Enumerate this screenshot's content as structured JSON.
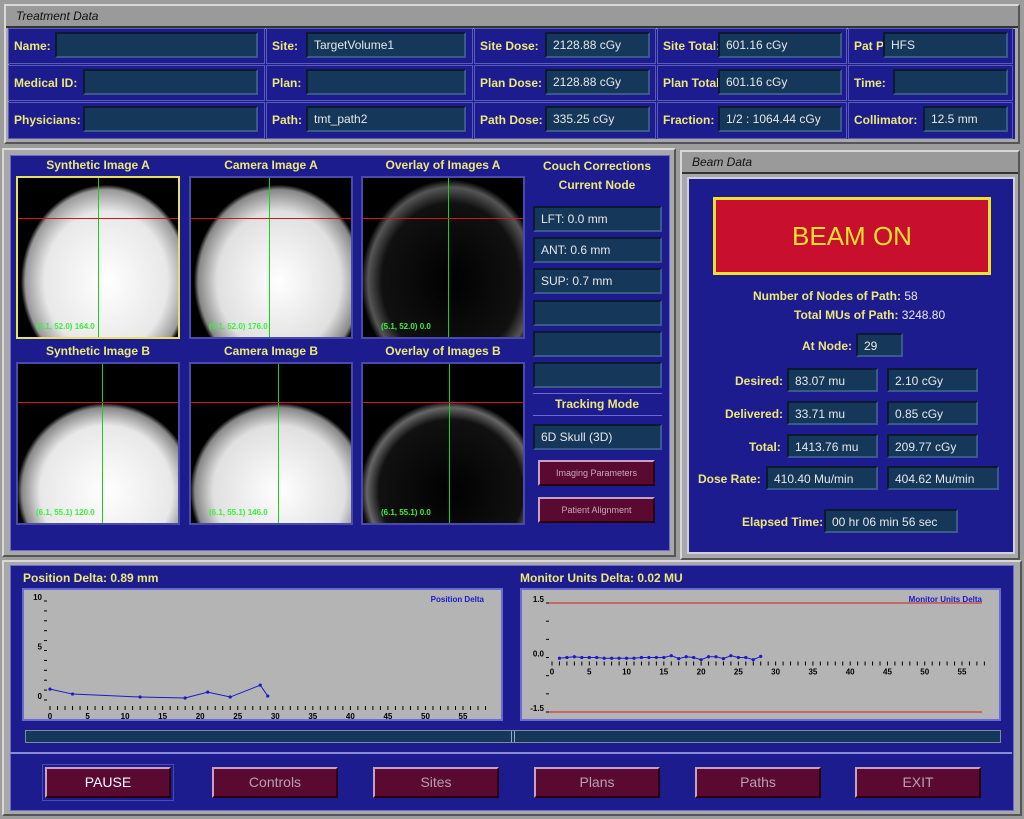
{
  "treatment": {
    "title": "Treatment Data",
    "name": {
      "label": "Name:",
      "value": ""
    },
    "medical_id": {
      "label": "Medical ID:",
      "value": ""
    },
    "physicians": {
      "label": "Physicians:",
      "value": ""
    },
    "site": {
      "label": "Site:",
      "value": "TargetVolume1"
    },
    "plan": {
      "label": "Plan:",
      "value": ""
    },
    "path": {
      "label": "Path:",
      "value": "tmt_path2"
    },
    "site_dose": {
      "label": "Site Dose:",
      "value": "2128.88 cGy"
    },
    "plan_dose": {
      "label": "Plan Dose:",
      "value": "2128.88 cGy"
    },
    "path_dose": {
      "label": "Path Dose:",
      "value": "335.25 cGy"
    },
    "site_total": {
      "label": "Site Total:",
      "value": "601.16 cGy"
    },
    "plan_total": {
      "label": "Plan Total:",
      "value": "601.16 cGy"
    },
    "fraction": {
      "label": "Fraction:",
      "value": "1/2 : 1064.44 cGy"
    },
    "pat_pos": {
      "label": "Pat  Pos:",
      "value": "HFS"
    },
    "time": {
      "label": "Time:",
      "value": ""
    },
    "collimator": {
      "label": "Collimator:",
      "value": "12.5 mm"
    }
  },
  "images": {
    "syn_a": {
      "label": "Synthetic Image A",
      "coord": "(5.1, 52.0) 164.0"
    },
    "cam_a": {
      "label": "Camera Image A",
      "coord": "(5.1, 52.0) 176.0"
    },
    "ovl_a": {
      "label": "Overlay of Images A",
      "coord": "(5.1, 52.0) 0.0"
    },
    "syn_b": {
      "label": "Synthetic Image B",
      "coord": "(6.1, 55.1) 120.0"
    },
    "cam_b": {
      "label": "Camera Image B",
      "coord": "(6.1, 55.1) 146.0"
    },
    "ovl_b": {
      "label": "Overlay of Images B",
      "coord": "(6.1, 55.1) 0.0"
    }
  },
  "couch": {
    "title": "Couch Corrections",
    "subtitle": "Current Node",
    "lft": "LFT: 0.0 mm",
    "ant": "ANT: 0.6 mm",
    "sup": "SUP: 0.7 mm",
    "tracking_label": "Tracking Mode",
    "tracking_value": "6D Skull (3D)",
    "imaging_btn": "Imaging Parameters",
    "alignment_btn": "Patient Alignment"
  },
  "beam": {
    "title": "Beam Data",
    "status": "BEAM ON",
    "status_bg": "#c8102e",
    "status_fg": "#f0e030",
    "nodes_label": "Number of Nodes of Path:",
    "nodes": "58",
    "mus_label": "Total MUs of Path:",
    "mus": "3248.80",
    "at_node_label": "At Node:",
    "at_node": "29",
    "desired_label": "Desired:",
    "desired_mu": "83.07 mu",
    "desired_cgy": "2.10 cGy",
    "delivered_label": "Delivered:",
    "delivered_mu": "33.71 mu",
    "delivered_cgy": "0.85 cGy",
    "total_label": "Total:",
    "total_mu": "1413.76 mu",
    "total_cgy": "209.77 cGy",
    "rate_label": "Dose Rate:",
    "rate1": "410.40 Mu/min",
    "rate2": "404.62 Mu/min",
    "elapsed_label": "Elapsed Time:",
    "elapsed": "00 hr  06 min  56 sec"
  },
  "buttons": {
    "pause": "PAUSE",
    "controls": "Controls",
    "sites": "Sites",
    "plans": "Plans",
    "paths": "Paths",
    "exit": "EXIT"
  },
  "chart_data": [
    {
      "type": "line",
      "title": "Position Delta: 0.89 mm",
      "legend": "Position Delta",
      "legend_position": "top-right",
      "ylim": [
        0,
        10
      ],
      "xlim": [
        0,
        58
      ],
      "yticks": [
        "0",
        "5",
        "10"
      ],
      "xticks": [
        "0",
        "5",
        "10",
        "15",
        "20",
        "25",
        "30",
        "35",
        "40",
        "45",
        "50",
        "55"
      ],
      "x": [
        0,
        3,
        12,
        18,
        21,
        24,
        28,
        29
      ],
      "y": [
        1.1,
        0.6,
        0.3,
        0.2,
        0.8,
        0.3,
        1.5,
        0.4
      ],
      "color": "#1a1ac8"
    },
    {
      "type": "line",
      "title": "Monitor Units Delta: 0.02 MU",
      "legend": "Monitor Units Delta",
      "legend_position": "top-right",
      "ylim": [
        -1.5,
        1.5
      ],
      "xlim": [
        0,
        58
      ],
      "yticks": [
        "-1.5",
        "0.0",
        "1.5"
      ],
      "xticks": [
        "0",
        "5",
        "10",
        "15",
        "20",
        "25",
        "30",
        "35",
        "40",
        "45",
        "50",
        "55"
      ],
      "limit_lines": [
        1.5,
        -1.5
      ],
      "limit_color": "#d02020",
      "x": [
        1,
        2,
        3,
        4,
        5,
        6,
        7,
        8,
        9,
        10,
        11,
        12,
        13,
        14,
        15,
        16,
        17,
        18,
        19,
        20,
        21,
        22,
        23,
        24,
        25,
        26,
        27,
        28
      ],
      "y": [
        -0.02,
        0,
        0.02,
        0,
        0,
        0,
        -0.02,
        -0.02,
        -0.02,
        -0.02,
        -0.02,
        0,
        0,
        0,
        0,
        0.05,
        -0.03,
        0.02,
        0,
        -0.06,
        0.02,
        0.02,
        -0.03,
        0.05,
        0,
        0,
        -0.06,
        0.03
      ],
      "color": "#1a1ac8"
    }
  ]
}
